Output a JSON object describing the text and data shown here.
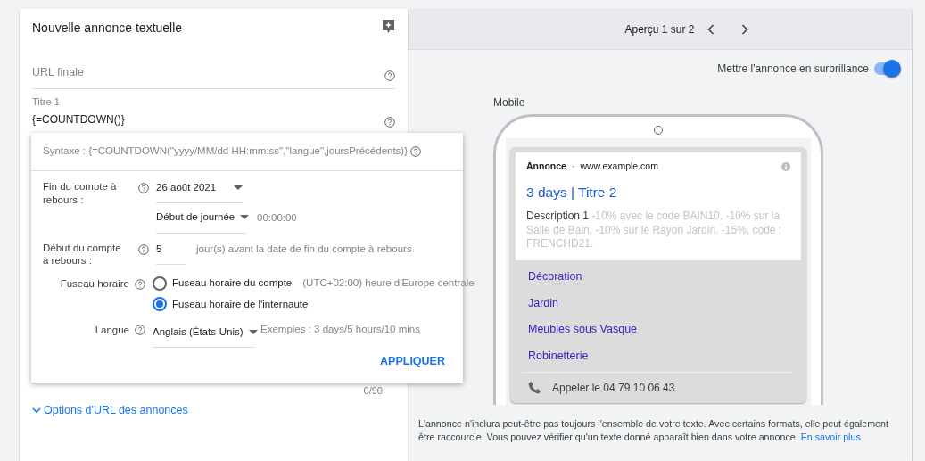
{
  "editor": {
    "title": "Nouvelle annonce textuelle",
    "final_url": {
      "placeholder": "URL finale"
    },
    "title_1": {
      "label": "Titre 1",
      "value": "{=COUNTDOWN()}"
    },
    "counter": "0/90",
    "url_options_link": "Options d'URL des annonces"
  },
  "countdown_popup": {
    "syntax": "Syntaxe : {=COUNTDOWN(\"yyyy/MM/dd HH:mm:ss\",\"langue\",joursPrécédents)}",
    "end": {
      "label": "Fin du compte à rebours :",
      "date": "26 août 2021",
      "time_of_day": "Début de journée",
      "time": "00:00:00"
    },
    "start": {
      "label": "Début du compte à rebours :",
      "value": "5",
      "suffix": "jour(s) avant la date de fin du compte à rebours"
    },
    "timezone": {
      "label": "Fuseau horaire",
      "options": [
        {
          "label": "Fuseau horaire du compte",
          "note": "(UTC+02:00) heure d'Europe centrale",
          "selected": false
        },
        {
          "label": "Fuseau horaire de l'internaute",
          "selected": true
        }
      ]
    },
    "language": {
      "label": "Langue",
      "value": "Anglais (États-Unis)",
      "examples": "Exemples : 3 days/5 hours/10 mins"
    },
    "apply_button": "APPLIQUER"
  },
  "preview": {
    "pager": "Aperçu 1 sur 2",
    "highlight": {
      "label": "Mettre l'annonce en surbrillance",
      "on": true
    },
    "device": "Mobile",
    "ad": {
      "badge": "Annonce",
      "separator": "·",
      "url": "www.example.com",
      "headline": "3 days | Titre 2",
      "description_label": "Description 1",
      "description": "-10% avec le code BAIN10. -10% sur la Salle de Bain. -10% sur le Rayon Jardin. -15%, code : FRENCHD21.",
      "sitelinks": [
        "Décoration",
        "Jardin",
        "Meubles sous Vasque",
        "Robinetterie"
      ],
      "call": "Appeler le 04 79 10 06 43"
    },
    "note": "L'annonce n'inclura peut-être pas toujours l'ensemble de votre texte. Avec certains formats, elle peut également être raccourcie. Vous pouvez vérifier qu'un texte donné apparaît bien dans votre annonce.",
    "note_link": "En savoir plus"
  }
}
